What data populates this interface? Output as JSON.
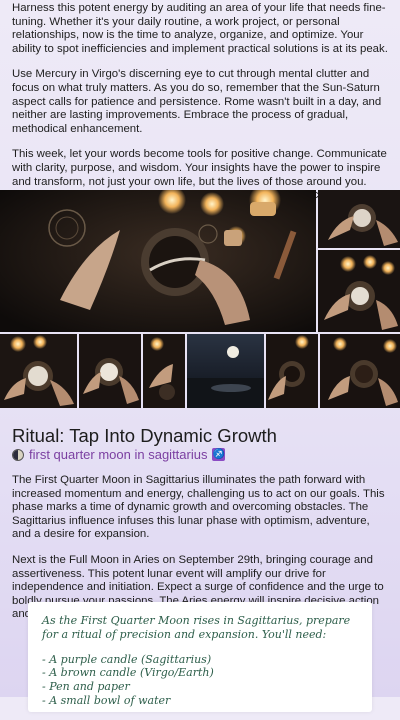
{
  "intro": {
    "p1": "Harness this potent energy by auditing an area of your life that needs fine-tuning. Whether it's your daily routine, a work project, or personal relationships, now is the time to analyze, organize, and optimize. Your ability to spot inefficiencies and implement practical solutions is at its peak.",
    "p2": "Use Mercury in Virgo's discerning eye to cut through mental clutter and focus on what truly matters. As you do so, remember that the Sun-Saturn aspect calls for patience and persistence. Rome wasn't built in a day, and neither are lasting improvements. Embrace the process of gradual, methodical enhancement.",
    "p3": "This week, let your words become tools for positive change. Communicate with clarity, purpose, and wisdom. Your insights have the power to inspire and transform, not just your own life, but the lives of those around you. Step into your role as a beacon of practical wisdom and watch as your refined approach ripples outward, creating waves of positive impact."
  },
  "ritual": {
    "title": "Ritual: Tap Into Dynamic Growth",
    "moon_phase": "first quarter moon in sagittarius",
    "moon_icon": "first-quarter-moon-icon",
    "zodiac_icon": "sagittarius-icon",
    "zodiac_glyph": "♐",
    "p1": "The First Quarter Moon in Sagittarius illuminates the path forward with increased momentum and energy, challenging us to act on our goals. This phase marks a time of dynamic growth and overcoming obstacles. The Sagittarius influence infuses this lunar phase with optimism, adventure, and a desire for expansion.",
    "p2": "Next is the Full Moon in Aries on September 29th, bringing courage and assertiveness. This potent lunar event will amplify our drive for independence and initiation. Expect a surge of confidence and the urge to boldly pursue your passions. The Aries energy will inspire decisive action and the courage to embrace new beginnings."
  },
  "note": {
    "intro": "As the First Quarter Moon rises in Sagittarius, prepare for a ritual of precision and expansion. You'll need:",
    "items": [
      "- A purple candle (Sagittarius)",
      "- A brown candle (Virgo/Earth)",
      "- Pen and paper",
      "- A small bowl of water"
    ]
  },
  "colors": {
    "accent": "#7b3fa1",
    "note_text": "#2d5e4a",
    "background": "#e9e4f6"
  }
}
